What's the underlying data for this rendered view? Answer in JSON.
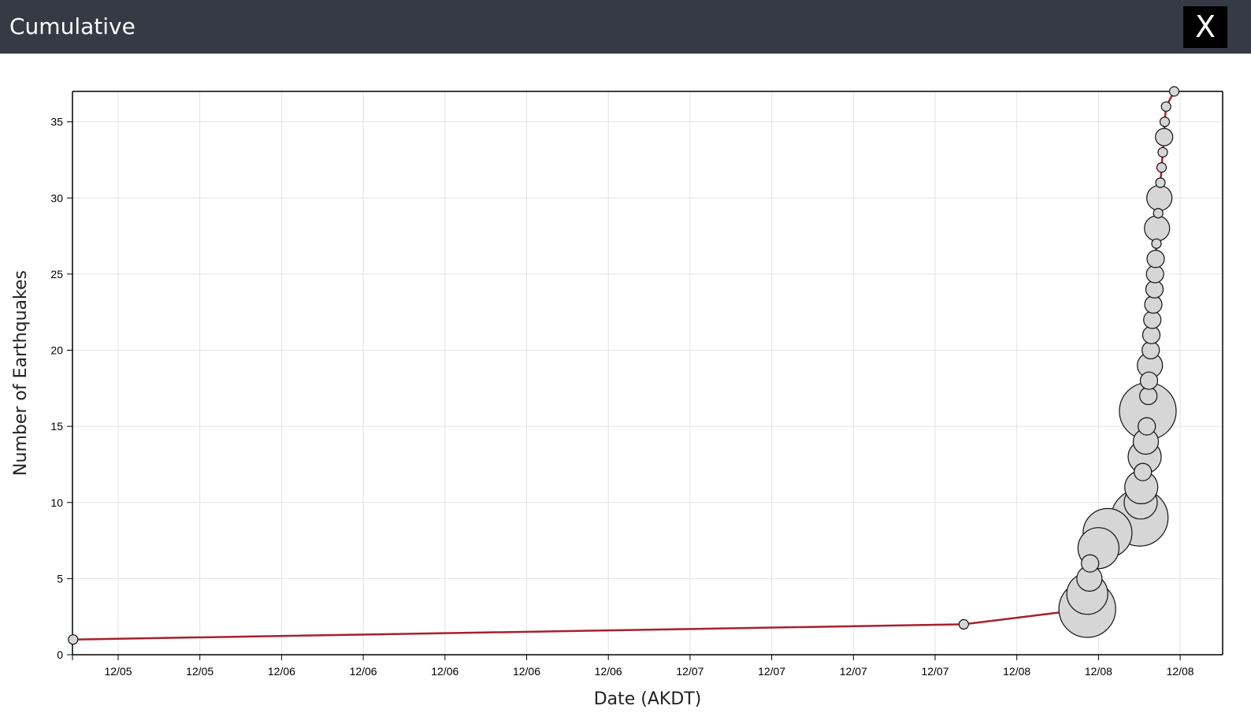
{
  "window": {
    "title": "Cumulative",
    "close_label": "X"
  },
  "chart_data": {
    "type": "scatter",
    "xlabel": "Date (AKDT)",
    "ylabel": "Number of Earthquakes",
    "ylim": [
      0,
      37
    ],
    "yticks": [
      0,
      5,
      10,
      15,
      20,
      25,
      30,
      35
    ],
    "xlim": [
      "12/04 22:42",
      "12/09 00:00"
    ],
    "xticks": [
      {
        "label": "12/05",
        "t": "12/05 00:00"
      },
      {
        "label": "12/05",
        "t": "12/05 12:00"
      },
      {
        "label": "12/06",
        "t": "12/06 00:00"
      },
      {
        "label": "12/06",
        "t": "12/06 12:00"
      },
      {
        "label": "12/06",
        "t": "12/07 00:00"
      },
      {
        "label": "12/06",
        "t": "12/07 12:00"
      },
      {
        "label": "12/06",
        "t": "12/08 00:00"
      },
      {
        "label": "12/07",
        "t": "12/08 12:00"
      },
      {
        "label": "12/07",
        "t": "12/09 00:00"
      },
      {
        "label": "12/07",
        "t": "12/09 12:00"
      },
      {
        "label": "12/07",
        "t": "12/10 00:00"
      },
      {
        "label": "12/08",
        "t": "12/10 12:00"
      },
      {
        "label": "12/08",
        "t": "12/11 00:00"
      },
      {
        "label": "12/08",
        "t": "12/11 12:00"
      }
    ],
    "grid": true,
    "line_color": "#a8202e",
    "marker_fill": "#d6d6d6",
    "marker_stroke": "#111111",
    "points": [
      {
        "t": "12/04 22:45",
        "count": 1,
        "size": 1
      },
      {
        "t": "12/08 02:06",
        "count": 2,
        "size": 1
      },
      {
        "t": "12/08 12:33",
        "count": 3,
        "size": 7
      },
      {
        "t": "12/08 12:33",
        "count": 4,
        "size": 5
      },
      {
        "t": "12/08 12:44",
        "count": 5,
        "size": 3
      },
      {
        "t": "12/08 12:47",
        "count": 6,
        "size": 2
      },
      {
        "t": "12/08 13:30",
        "count": 7,
        "size": 5
      },
      {
        "t": "12/08 14:16",
        "count": 8,
        "size": 6
      },
      {
        "t": "12/08 16:59",
        "count": 9,
        "size": 7
      },
      {
        "t": "12/08 17:04",
        "count": 10,
        "size": 4
      },
      {
        "t": "12/08 17:07",
        "count": 11,
        "size": 4
      },
      {
        "t": "12/08 17:15",
        "count": 12,
        "size": 2
      },
      {
        "t": "12/08 17:24",
        "count": 13,
        "size": 4
      },
      {
        "t": "12/08 17:30",
        "count": 14,
        "size": 3
      },
      {
        "t": "12/08 17:35",
        "count": 15,
        "size": 2
      },
      {
        "t": "12/08 17:40",
        "count": 16,
        "size": 7
      },
      {
        "t": "12/08 17:43",
        "count": 17,
        "size": 2
      },
      {
        "t": "12/08 17:46",
        "count": 18,
        "size": 2
      },
      {
        "t": "12/08 17:51",
        "count": 19,
        "size": 3
      },
      {
        "t": "12/08 17:55",
        "count": 20,
        "size": 2
      },
      {
        "t": "12/08 17:58",
        "count": 21,
        "size": 2
      },
      {
        "t": "12/08 18:03",
        "count": 22,
        "size": 2
      },
      {
        "t": "12/08 18:08",
        "count": 23,
        "size": 2
      },
      {
        "t": "12/08 18:14",
        "count": 24,
        "size": 2
      },
      {
        "t": "12/08 18:17",
        "count": 25,
        "size": 2
      },
      {
        "t": "12/08 18:20",
        "count": 26,
        "size": 2
      },
      {
        "t": "12/08 18:24",
        "count": 27,
        "size": 1
      },
      {
        "t": "12/08 18:27",
        "count": 28,
        "size": 3
      },
      {
        "t": "12/08 18:33",
        "count": 29,
        "size": 1
      },
      {
        "t": "12/08 18:39",
        "count": 30,
        "size": 3
      },
      {
        "t": "12/08 18:44",
        "count": 31,
        "size": 1
      },
      {
        "t": "12/08 18:50",
        "count": 32,
        "size": 1
      },
      {
        "t": "12/08 18:56",
        "count": 33,
        "size": 1
      },
      {
        "t": "12/08 19:03",
        "count": 34,
        "size": 2
      },
      {
        "t": "12/08 19:06",
        "count": 35,
        "size": 1
      },
      {
        "t": "12/08 19:13",
        "count": 36,
        "size": 1
      },
      {
        "t": "12/08 19:54",
        "count": 37,
        "size": 1
      }
    ]
  }
}
